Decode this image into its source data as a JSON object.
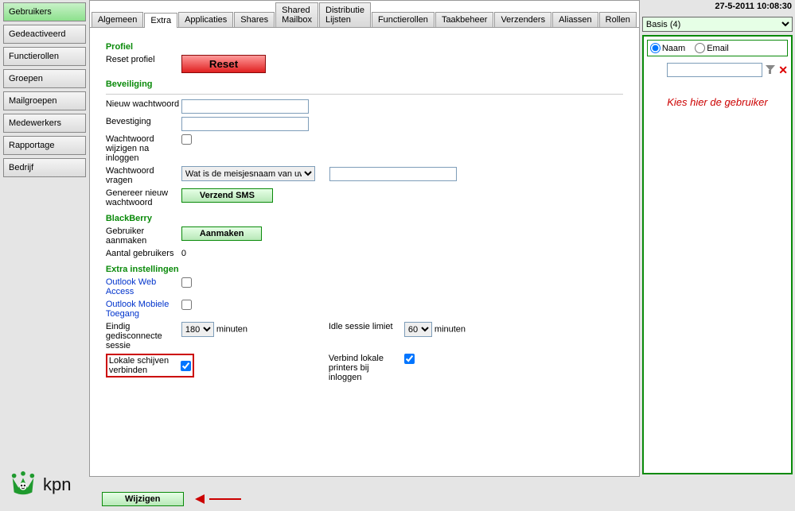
{
  "timestamp": "27-5-2011 10:08:30",
  "sidebar": {
    "items": [
      {
        "label": "Gebruikers",
        "active": true
      },
      {
        "label": "Gedeactiveerd"
      },
      {
        "label": "Functierollen"
      },
      {
        "label": "Groepen"
      },
      {
        "label": "Mailgroepen"
      },
      {
        "label": "Medewerkers"
      },
      {
        "label": "Rapportage"
      },
      {
        "label": "Bedrijf"
      }
    ]
  },
  "tabs": {
    "items": [
      {
        "label": "Algemeen"
      },
      {
        "label": "Extra",
        "active": true
      },
      {
        "label": "Applicaties"
      },
      {
        "label": "Shares"
      },
      {
        "label": "Shared Mailbox"
      },
      {
        "label": "Distributie Lijsten"
      },
      {
        "label": "Functierollen"
      },
      {
        "label": "Taakbeheer"
      },
      {
        "label": "Verzenders"
      },
      {
        "label": "Aliassen"
      },
      {
        "label": "Rollen"
      }
    ]
  },
  "sections": {
    "profiel": {
      "title": "Profiel",
      "reset_label": "Reset profiel",
      "reset_button": "Reset"
    },
    "beveiliging": {
      "title": "Beveiliging",
      "nieuw_ww_label": "Nieuw wachtwoord",
      "bevestiging_label": "Bevestiging",
      "wijzigen_na_label": "Wachtwoord wijzigen na inloggen",
      "vragen_label": "Wachtwoord vragen",
      "vragen_option": "Wat is de meisjesnaam van uw",
      "genereer_label": "Genereer nieuw wachtwoord",
      "verzend_button": "Verzend SMS"
    },
    "blackberry": {
      "title": "BlackBerry",
      "aanmaken_label": "Gebruiker aanmaken",
      "aanmaken_button": "Aanmaken",
      "aantal_label": "Aantal gebruikers",
      "aantal_value": "0"
    },
    "extra": {
      "title": "Extra instellingen",
      "owa_label": "Outlook Web Access",
      "mobile_label": "Outlook Mobiele Toegang",
      "eindig_label": "Eindig gedisconnecte sessie",
      "eindig_value": "180",
      "minuten": "minuten",
      "idle_label": "Idle sessie limiet",
      "idle_value": "60",
      "lokale_label": "Lokale schijven verbinden",
      "printers_label": "Verbind lokale printers bij inloggen"
    }
  },
  "rightpanel": {
    "select_value": "Basis (4)",
    "radio_naam": "Naam",
    "radio_email": "Email",
    "placeholder_text": "Kies hier de gebruiker"
  },
  "bottom": {
    "wijzigen": "Wijzigen"
  },
  "brand": {
    "name": "kpn"
  }
}
